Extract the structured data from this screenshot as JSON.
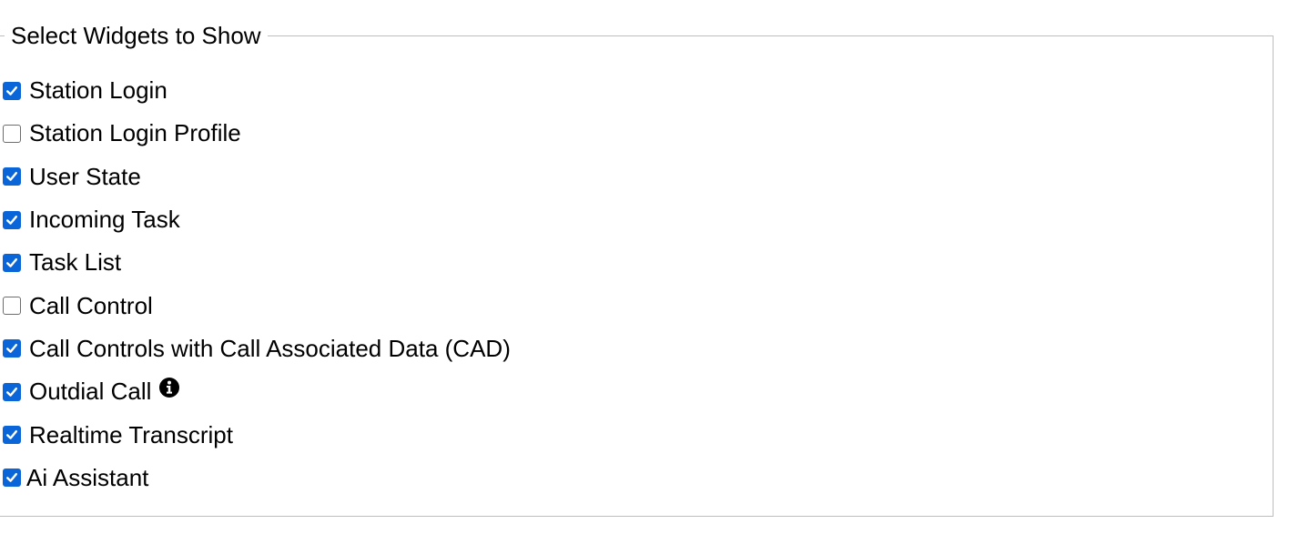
{
  "panel": {
    "legend": "Select Widgets to Show"
  },
  "widgets": [
    {
      "label": "Station Login",
      "checked": true
    },
    {
      "label": "Station Login Profile",
      "checked": false
    },
    {
      "label": "User State",
      "checked": true
    },
    {
      "label": "Incoming Task",
      "checked": true
    },
    {
      "label": "Task List",
      "checked": true
    },
    {
      "label": "Call Control",
      "checked": false
    },
    {
      "label": "Call Controls with Call Associated Data (CAD)",
      "checked": true
    },
    {
      "label": "Outdial Call",
      "checked": true,
      "icon": "info-icon"
    },
    {
      "label": "Realtime Transcript",
      "checked": true
    },
    {
      "label": "Ai Assistant",
      "checked": true
    }
  ],
  "colors": {
    "checkbox_checked": "#0a66d8",
    "border": "#bdbdbd"
  }
}
